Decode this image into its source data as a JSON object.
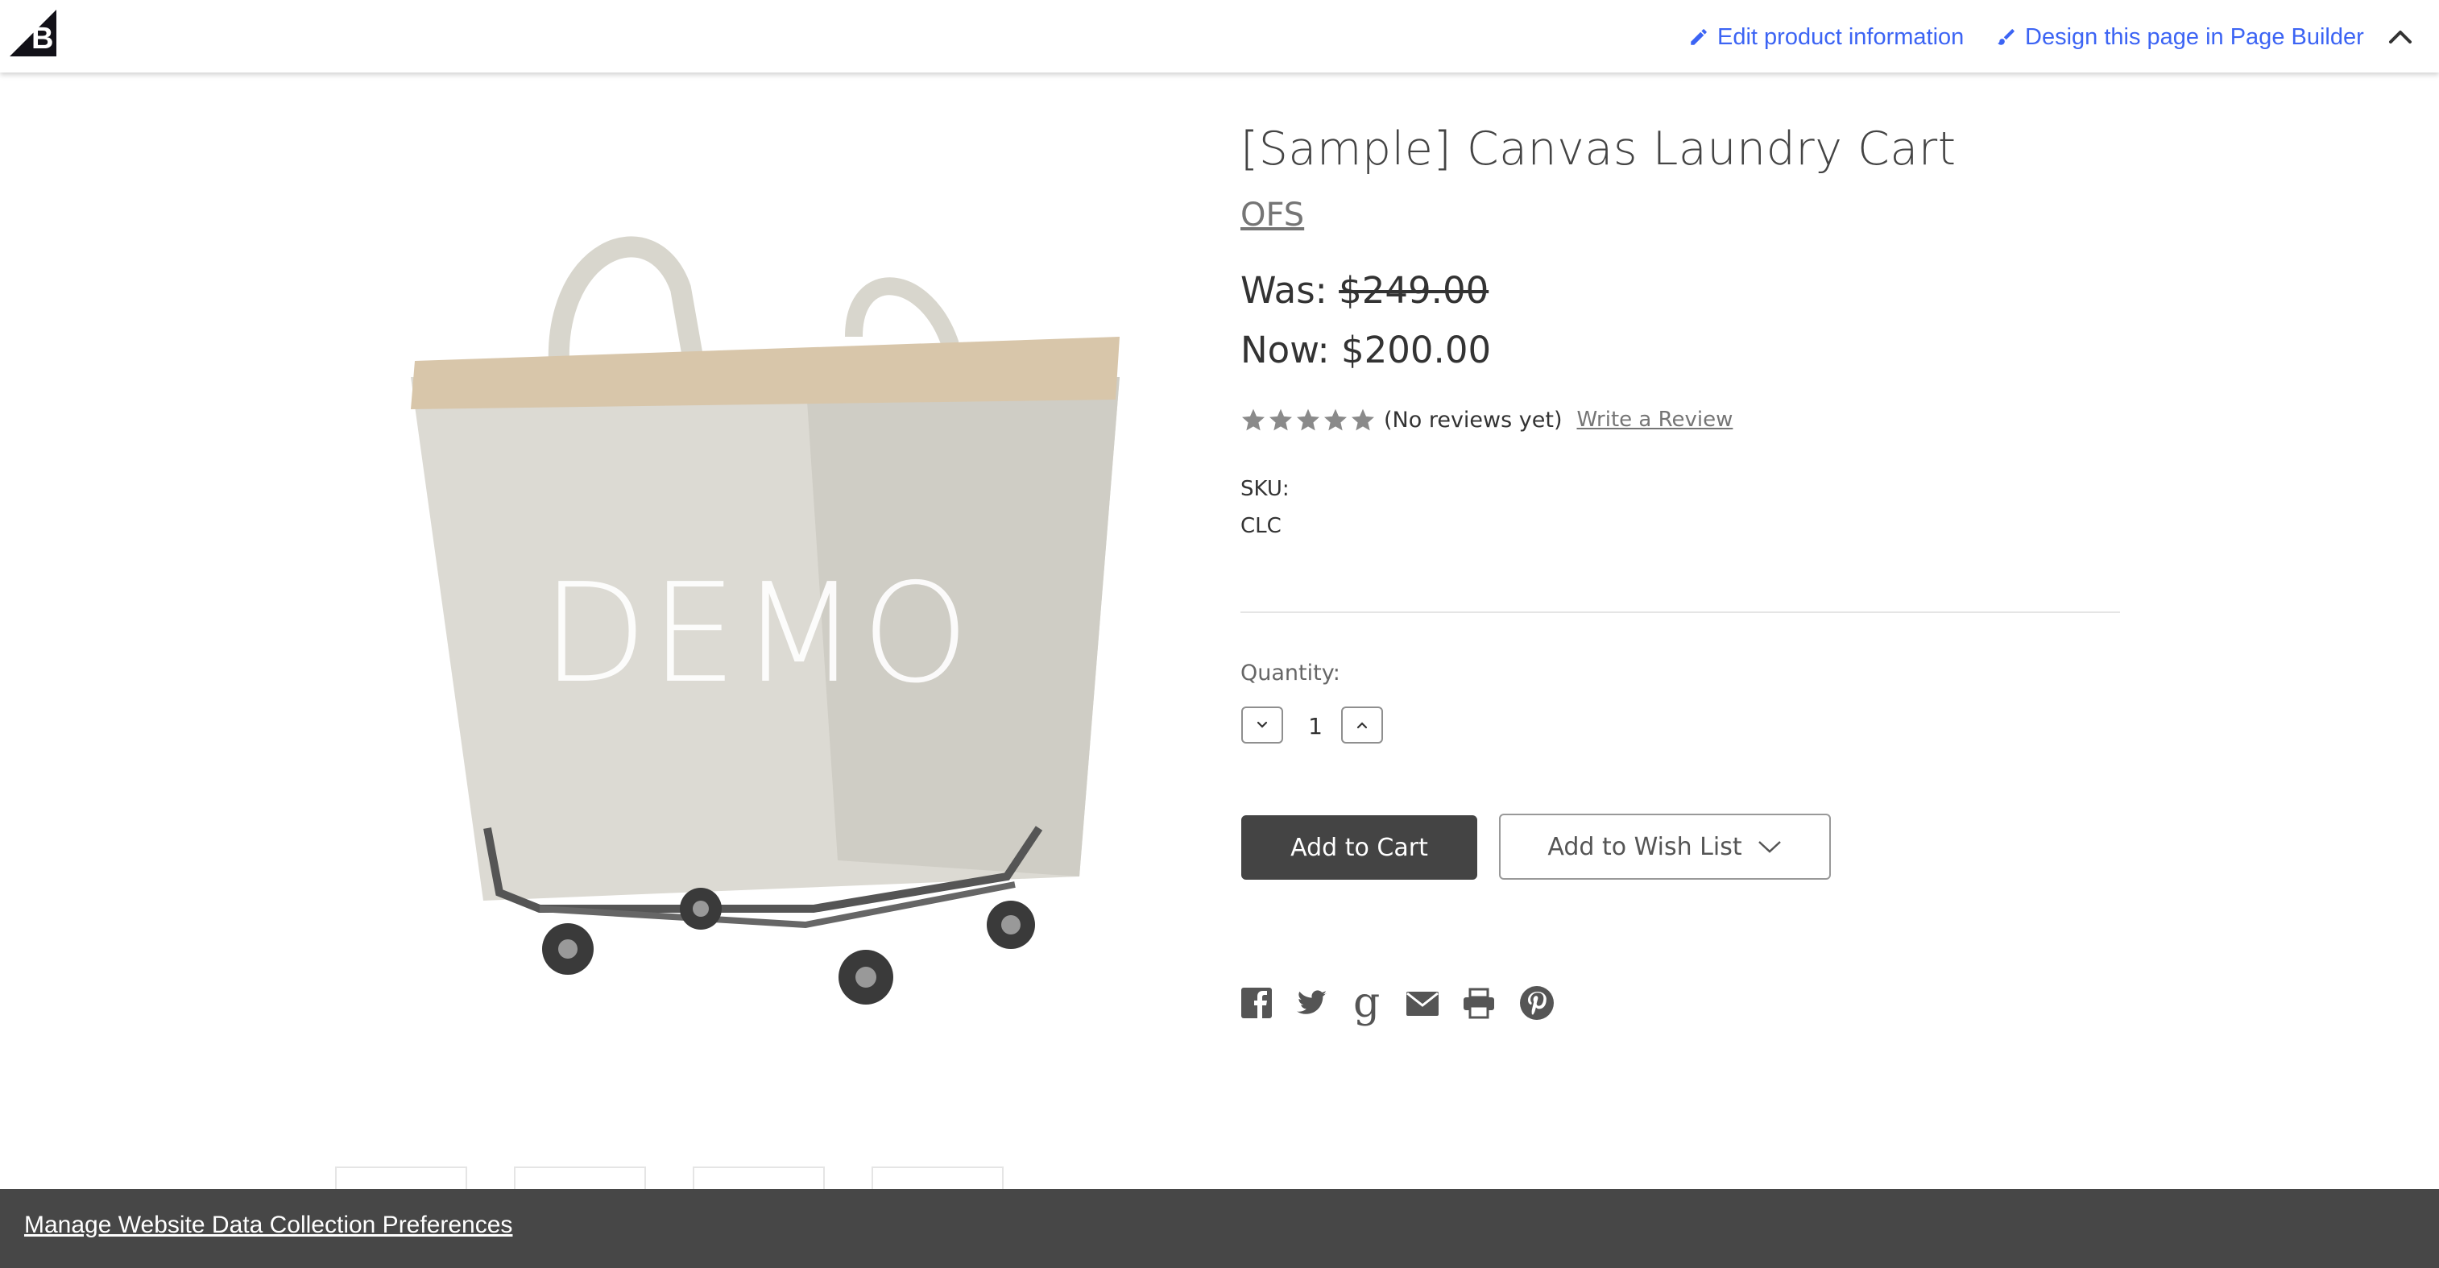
{
  "admin_bar": {
    "edit_link": "Edit product information",
    "design_link": "Design this page in Page Builder",
    "accent_color": "#3c64f4"
  },
  "product": {
    "title": "[Sample] Canvas Laundry Cart",
    "brand": "OFS",
    "image_watermark": "DEMO",
    "was_label": "Was:",
    "was_price": "$249.00",
    "now_label": "Now:",
    "now_price": "$200.00",
    "rating": 0,
    "reviews_text": "(No reviews yet)",
    "write_review": "Write a Review",
    "sku_label": "SKU:",
    "sku_value": "CLC",
    "quantity_label": "Quantity:",
    "quantity_value": "1",
    "add_to_cart": "Add to Cart",
    "add_to_wishlist": "Add to Wish List"
  },
  "share_icons": [
    "facebook-icon",
    "twitter-icon",
    "google-icon",
    "email-icon",
    "print-icon",
    "pinterest-icon"
  ],
  "cookie_bar": {
    "link": "Manage Website Data Collection Preferences"
  }
}
